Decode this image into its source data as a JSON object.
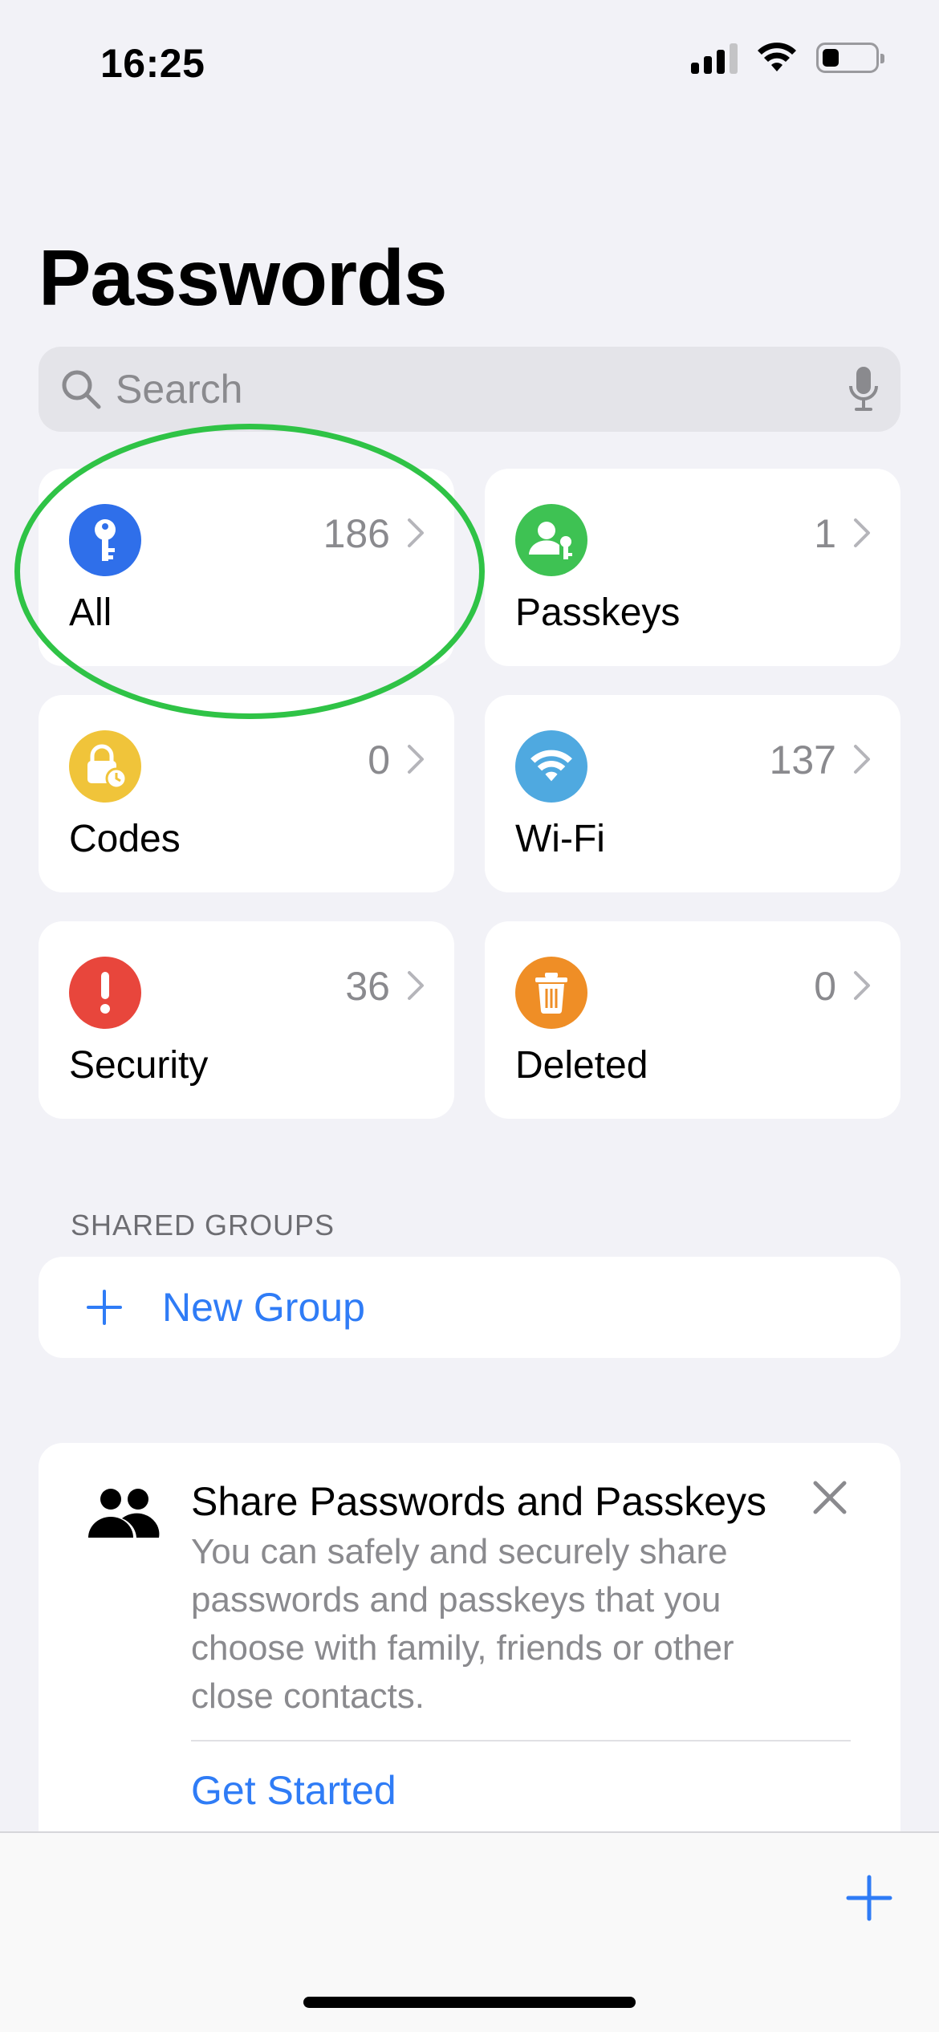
{
  "status_bar": {
    "time": "16:25"
  },
  "header": {
    "title": "Passwords"
  },
  "search": {
    "placeholder": "Search"
  },
  "categories": [
    {
      "label": "All",
      "count": "186",
      "color": "#2f6fea",
      "icon": "key-icon"
    },
    {
      "label": "Passkeys",
      "count": "1",
      "color": "#3ec253",
      "icon": "person-key-icon"
    },
    {
      "label": "Codes",
      "count": "0",
      "color": "#f0c43a",
      "icon": "lock-clock-icon"
    },
    {
      "label": "Wi-Fi",
      "count": "137",
      "color": "#4fa9e0",
      "icon": "wifi-icon"
    },
    {
      "label": "Security",
      "count": "36",
      "color": "#e8463c",
      "icon": "exclamation-icon"
    },
    {
      "label": "Deleted",
      "count": "0",
      "color": "#ef8e26",
      "icon": "trash-icon"
    }
  ],
  "shared_groups": {
    "header": "SHARED GROUPS",
    "new_group_label": "New Group"
  },
  "share_card": {
    "title": "Share Passwords and Passkeys",
    "body": "You can safely and securely share passwords and passkeys that you choose with family, friends or other close contacts.",
    "action": "Get Started"
  },
  "colors": {
    "accent": "#2f7cf6",
    "highlight": "#2fc346",
    "background": "#f2f2f7"
  }
}
